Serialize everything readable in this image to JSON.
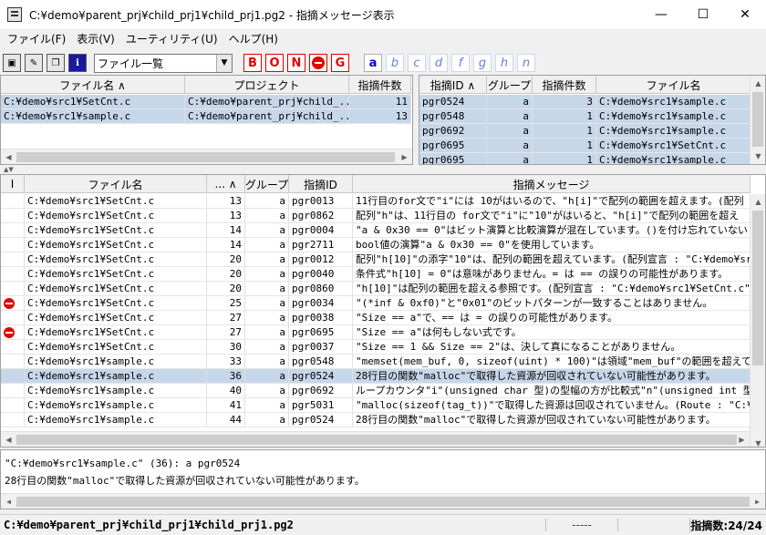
{
  "window": {
    "title": "C:¥demo¥parent_prj¥child_prj1¥child_prj1.pg2 - 指摘メッセージ表示",
    "minimize": "—",
    "maximize": "☐",
    "close": "✕"
  },
  "menu": [
    {
      "label": "ファイル(F)"
    },
    {
      "label": "表示(V)"
    },
    {
      "label": "ユーティリティ(U)"
    },
    {
      "label": "ヘルプ(H)"
    }
  ],
  "toolbar": {
    "icons": [
      "save-icon",
      "edit-icon",
      "copy-icon",
      "info-icon"
    ],
    "info_label": "i",
    "combo_value": "ファイル一覧",
    "combo_arrow": "▼",
    "severity_flags": [
      "B",
      "O",
      "N",
      "",
      "G"
    ],
    "letter_flags": [
      "a",
      "b",
      "c",
      "d",
      "f",
      "g",
      "h",
      "n"
    ]
  },
  "files_panel": {
    "headers": [
      "ファイル名 ∧",
      "プロジェクト",
      "指摘件数"
    ],
    "rows": [
      [
        "C:¥demo¥src1¥SetCnt.c",
        "C:¥demo¥parent_prj¥child_...",
        "11"
      ],
      [
        "C:¥demo¥src1¥sample.c",
        "C:¥demo¥parent_prj¥child_...",
        "13"
      ]
    ]
  },
  "ids_panel": {
    "headers": [
      "指摘ID ∧",
      "グループ",
      "指摘件数",
      "ファイル名"
    ],
    "rows": [
      [
        "pgr0524",
        "a",
        "3",
        "C:¥demo¥src1¥sample.c"
      ],
      [
        "pgr0548",
        "a",
        "1",
        "C:¥demo¥src1¥sample.c"
      ],
      [
        "pgr0692",
        "a",
        "1",
        "C:¥demo¥src1¥sample.c"
      ],
      [
        "pgr0695",
        "a",
        "1",
        "C:¥demo¥src1¥SetCnt.c"
      ],
      [
        "pgr0695",
        "a",
        "1",
        "C:¥demo¥src1¥sample.c"
      ]
    ]
  },
  "messages_panel": {
    "headers": [
      "I",
      "ファイル名",
      "...  ∧",
      "グループ",
      "指摘ID",
      "指摘メッセージ"
    ],
    "rows": [
      {
        "icon": "",
        "file": "C:¥demo¥src1¥SetCnt.c",
        "line": "13",
        "group": "a",
        "id": "pgr0013",
        "msg": "11行目のfor文で\"i\"には 10がはいるので、\"h[i]\"で配列の範囲を超えます。(配列"
      },
      {
        "icon": "",
        "file": "C:¥demo¥src1¥SetCnt.c",
        "line": "13",
        "group": "a",
        "id": "pgr0862",
        "msg": "配列\"h\"は、11行目の for文で\"i\"に\"10\"がはいると、\"h[i]\"で配列の範囲を超え"
      },
      {
        "icon": "",
        "file": "C:¥demo¥src1¥SetCnt.c",
        "line": "14",
        "group": "a",
        "id": "pgr0004",
        "msg": "\"a & 0x30 == 0\"はビット演算と比較演算が混在しています。()を付け忘れていない"
      },
      {
        "icon": "",
        "file": "C:¥demo¥src1¥SetCnt.c",
        "line": "14",
        "group": "a",
        "id": "pgr2711",
        "msg": "bool値の演算\"a & 0x30 == 0\"を使用しています。"
      },
      {
        "icon": "",
        "file": "C:¥demo¥src1¥SetCnt.c",
        "line": "20",
        "group": "a",
        "id": "pgr0012",
        "msg": "配列\"h[10]\"の添字\"10\"は、配列の範囲を超えています。(配列宣言 : \"C:¥demo¥src"
      },
      {
        "icon": "",
        "file": "C:¥demo¥src1¥SetCnt.c",
        "line": "20",
        "group": "a",
        "id": "pgr0040",
        "msg": "条件式\"h[10] = 0\"は意味がありません。= は == の誤りの可能性があります。"
      },
      {
        "icon": "",
        "file": "C:¥demo¥src1¥SetCnt.c",
        "line": "20",
        "group": "a",
        "id": "pgr0860",
        "msg": "\"h[10]\"は配列の範囲を超える参照です。(配列宣言 : \"C:¥demo¥src1¥SetCnt.c\" 9"
      },
      {
        "icon": "error",
        "file": "C:¥demo¥src1¥SetCnt.c",
        "line": "25",
        "group": "a",
        "id": "pgr0034",
        "msg": "\"(*inf & 0xf0)\"と\"0x01\"のビットパターンが一致することはありません。"
      },
      {
        "icon": "",
        "file": "C:¥demo¥src1¥SetCnt.c",
        "line": "27",
        "group": "a",
        "id": "pgr0038",
        "msg": "\"Size == a\"で、== は = の誤りの可能性があります。"
      },
      {
        "icon": "error",
        "file": "C:¥demo¥src1¥SetCnt.c",
        "line": "27",
        "group": "a",
        "id": "pgr0695",
        "msg": "\"Size == a\"は何もしない式です。"
      },
      {
        "icon": "",
        "file": "C:¥demo¥src1¥SetCnt.c",
        "line": "30",
        "group": "a",
        "id": "pgr0037",
        "msg": "\"Size == 1 && Size == 2\"は、決して真になることがありません。"
      },
      {
        "icon": "",
        "file": "C:¥demo¥src1¥sample.c",
        "line": "33",
        "group": "a",
        "id": "pgr0548",
        "msg": "\"memset(mem_buf, 0, sizeof(uint) * 100)\"は領域\"mem_buf\"の範囲を超えてアク"
      },
      {
        "icon": "",
        "file": "C:¥demo¥src1¥sample.c",
        "line": "36",
        "group": "a",
        "id": "pgr0524",
        "msg": "28行目の関数\"malloc\"で取得した資源が回収されていない可能性があります。",
        "selected": true
      },
      {
        "icon": "",
        "file": "C:¥demo¥src1¥sample.c",
        "line": "40",
        "group": "a",
        "id": "pgr0692",
        "msg": "ループカウンタ\"i\"(unsigned char 型)の型幅の方が比較式\"n\"(unsigned int 型)"
      },
      {
        "icon": "",
        "file": "C:¥demo¥src1¥sample.c",
        "line": "41",
        "group": "a",
        "id": "pgr5031",
        "msg": "\"malloc(sizeof(tag_t))\"で取得した資源は回収されていません。(Route : \"C:¥de"
      },
      {
        "icon": "",
        "file": "C:¥demo¥src1¥sample.c",
        "line": "44",
        "group": "a",
        "id": "pgr0524",
        "msg": "28行目の関数\"malloc\"で取得した資源が回収されていない可能性があります。"
      }
    ]
  },
  "detail": {
    "line1": "\"C:¥demo¥src1¥sample.c\" (36): a pgr0524",
    "line2": "28行目の関数\"malloc\"で取得した資源が回収されていない可能性があります。"
  },
  "status": {
    "path": "C:¥demo¥parent_prj¥child_prj1¥child_prj1.pg2",
    "middle": "-----",
    "count": "指摘数:24/24"
  }
}
